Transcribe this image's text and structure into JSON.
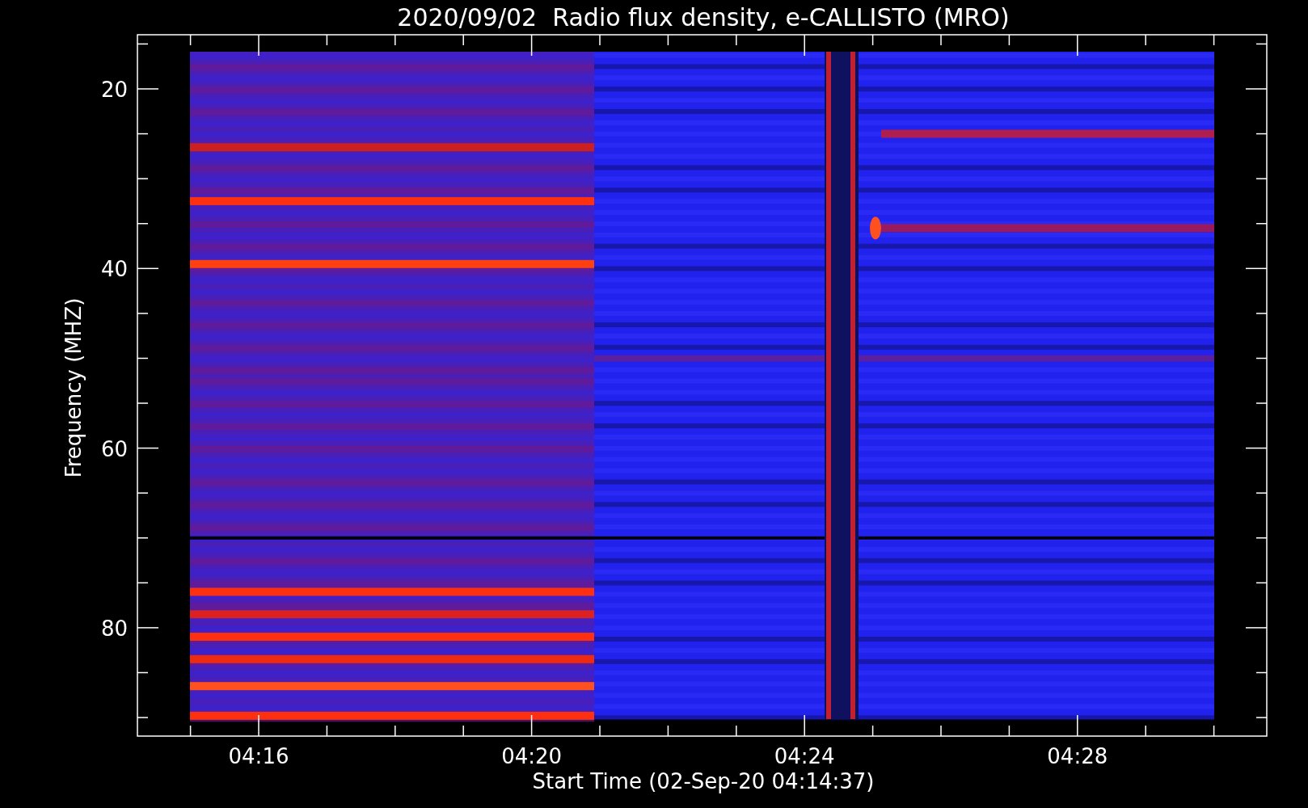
{
  "title": "2020/09/02  Radio flux density, e-CALLISTO (MRO)",
  "ylabel": "Frequency (MHZ)",
  "xlabel": "Start Time (02-Sep-20 04:14:37)",
  "yticks": [
    "20",
    "40",
    "60",
    "80"
  ],
  "xticks": [
    "04:16",
    "04:20",
    "04:24",
    "04:28"
  ]
}
